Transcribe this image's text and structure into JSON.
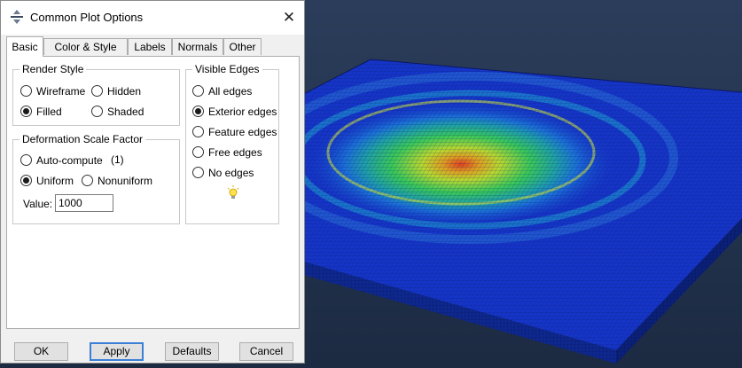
{
  "dialog": {
    "title": "Common Plot Options",
    "tabs": [
      "Basic",
      "Color & Style",
      "Labels",
      "Normals",
      "Other"
    ],
    "active_tab": "Basic",
    "render_style": {
      "title": "Render Style",
      "options": [
        {
          "label": "Wireframe",
          "checked": false
        },
        {
          "label": "Hidden",
          "checked": false
        },
        {
          "label": "Filled",
          "checked": true
        },
        {
          "label": "Shaded",
          "checked": false
        }
      ]
    },
    "deformation": {
      "title": "Deformation Scale Factor",
      "auto_label": "Auto-compute",
      "auto_value": "(1)",
      "uniform_label": "Uniform",
      "nonuniform_label": "Nonuniform",
      "value_label": "Value:",
      "value": "1000"
    },
    "visible_edges": {
      "title": "Visible Edges",
      "options": [
        {
          "label": "All edges",
          "checked": false
        },
        {
          "label": "Exterior edges",
          "checked": true
        },
        {
          "label": "Feature edges",
          "checked": false
        },
        {
          "label": "Free edges",
          "checked": false
        },
        {
          "label": "No edges",
          "checked": false
        }
      ]
    },
    "buttons": {
      "ok": "OK",
      "apply": "Apply",
      "defaults": "Defaults",
      "cancel": "Cancel"
    },
    "icons": {
      "title": "abaqus-logo-icon",
      "close": "close-icon",
      "hint": "lightbulb-icon"
    }
  },
  "colors": {
    "mesh_blue": "#1535c8",
    "accent": "#3c7fd6",
    "contour": [
      "#0d2fd0",
      "#1fa0d8",
      "#38c85a",
      "#d8e030",
      "#e04020"
    ]
  }
}
